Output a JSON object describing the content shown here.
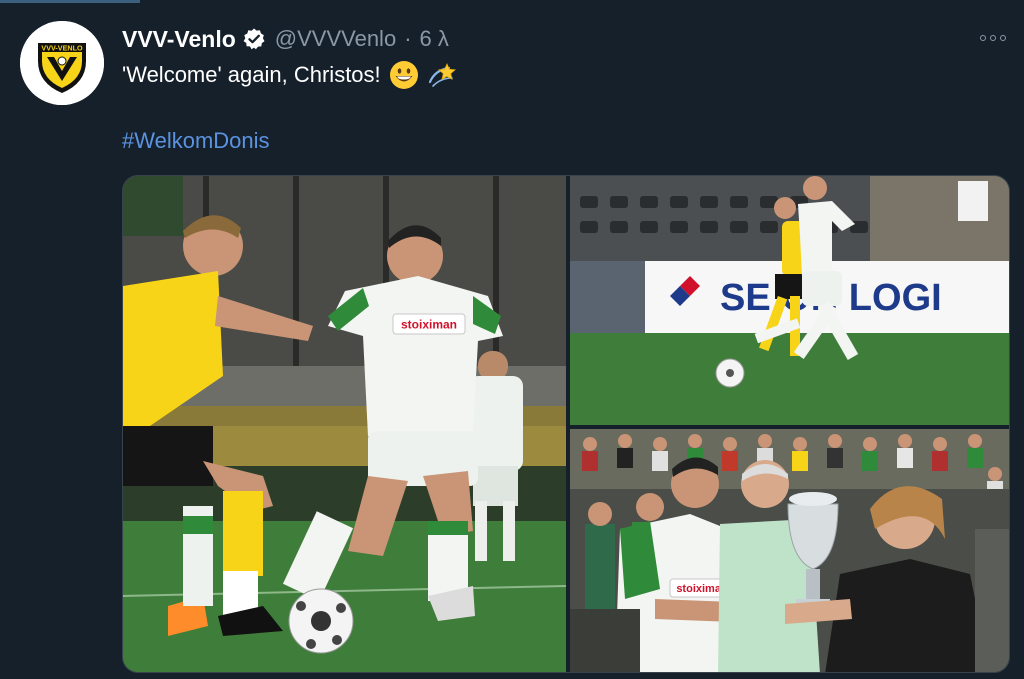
{
  "tweet": {
    "author_name": "VVV-Venlo",
    "handle": "@VVVVenlo",
    "separator": "·",
    "time": "6 λ",
    "text": "'Welcome' again, Christos!",
    "hashtag": "#WelkomDonis",
    "verified": true,
    "avatar_text": "VVV-VENLO",
    "emojis": [
      "grinning-face-emoji",
      "dizzy-star-emoji"
    ]
  },
  "media": {
    "photos": [
      {
        "shirt_sponsor": "stoiximan"
      },
      {
        "banner_text": "SE  ON LOGI"
      },
      {
        "shirt_sponsor": "stoiximan"
      }
    ]
  },
  "colors": {
    "background": "#15202b",
    "handle_gray": "#8b98a5",
    "link_blue": "#5b93e0",
    "vvv_yellow": "#f7d417",
    "pao_green": "#2f8a3a",
    "pitch_green": "#3f7d3a"
  }
}
